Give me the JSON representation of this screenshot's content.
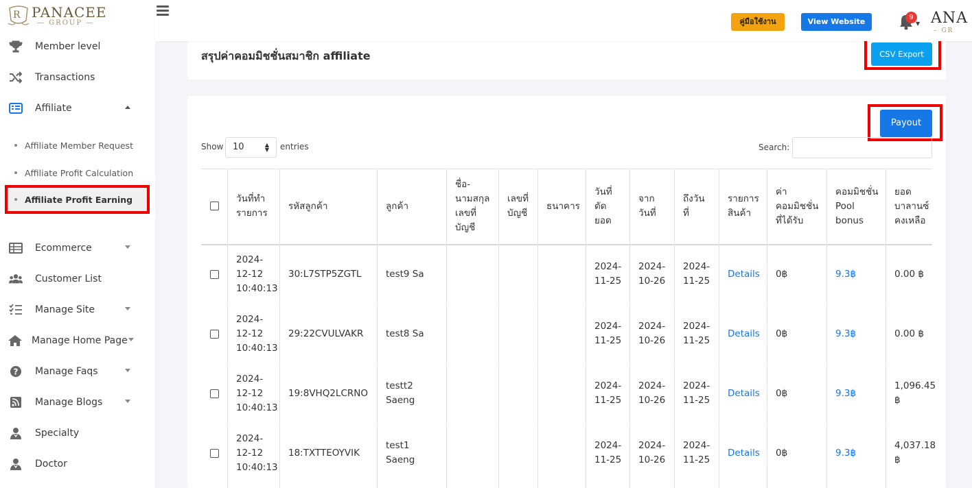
{
  "header": {
    "brand": "PANACEE",
    "brand_sub": "— GROUP —",
    "manual_label": "คู่มือใช้งาน",
    "website_label": "View Website",
    "notif_count": "9",
    "user_name": "ANA",
    "user_sub": "– GR"
  },
  "sidebar": {
    "items": [
      {
        "label": "Member level",
        "icon": "trophy-icon"
      },
      {
        "label": "Transactions",
        "icon": "shuffle-icon"
      },
      {
        "label": "Affiliate",
        "icon": "list-icon"
      },
      {
        "label": "Ecommerce",
        "icon": "table-icon"
      },
      {
        "label": "Customer List",
        "icon": "users-icon"
      },
      {
        "label": "Manage Site",
        "icon": "checklist-icon"
      },
      {
        "label": "Manage Home Page",
        "icon": "home-icon"
      },
      {
        "label": "Manage Faqs",
        "icon": "question-icon"
      },
      {
        "label": "Manage Blogs",
        "icon": "rss-icon"
      },
      {
        "label": "Specialty",
        "icon": "doctor-icon"
      },
      {
        "label": "Doctor",
        "icon": "doctor-icon"
      }
    ],
    "sub_items": [
      {
        "label": "Affiliate Member Request"
      },
      {
        "label": "Affiliate Profit Calculation"
      },
      {
        "label": "Affiliate Profit Earning"
      }
    ]
  },
  "page": {
    "title": "สรุปค่าคอมมิชชั่นสมาชิก affiliate",
    "csv_label": "CSV Export",
    "payout_label": "Payout",
    "show_label": "Show",
    "show_value": "10",
    "entries_label": "entries",
    "search_label": "Search:"
  },
  "table": {
    "headers": [
      "วันที่ทำรายการ",
      "รหัสลูกค้า",
      "ลูกค้า",
      "ชื่อ-นามสกุลเลขที่บัญชี",
      "เลขที่บัญชี",
      "ธนาคาร",
      "วันที่ตัดยอด",
      "จากวันที่",
      "ถึงวันที่",
      "รายการสินค้า",
      "ค่าคอมมิชชั่นที่ได้รับ",
      "คอมมิชชั่น Pool bonus",
      "ยอดบาลานซ์คงเหลือ"
    ],
    "header_lines": [
      [
        "วันที่ทำ",
        "รายการ"
      ],
      [
        "รหัสลูกค้า"
      ],
      [
        "ลูกค้า"
      ],
      [
        "ชื่อ-",
        "นามสกุล",
        "เลขที่",
        "บัญชี"
      ],
      [
        "เลขที่",
        "บัญชี"
      ],
      [
        "ธนาคาร"
      ],
      [
        "วันที่",
        "ตัด",
        "ยอด"
      ],
      [
        "จาก",
        "วันที่"
      ],
      [
        "ถึงวัน",
        "ที่"
      ],
      [
        "รายการ",
        "สินค้า"
      ],
      [
        "ค่า",
        "คอมมิชชั่น",
        "ที่ได้รับ"
      ],
      [
        "คอมมิชชั่น",
        "Pool",
        "bonus"
      ],
      [
        "ยอด",
        "บาลานซ์",
        "คงเหลือ"
      ]
    ],
    "rows": [
      {
        "date": [
          "2024-",
          "12-12",
          "10:40:13"
        ],
        "code": "30:L7STP5ZGTL",
        "customer": [
          "test9 Sa"
        ],
        "cut": [
          "2024-",
          "11-25"
        ],
        "from": [
          "2024-",
          "10-26"
        ],
        "to": [
          "2024-",
          "11-25"
        ],
        "details": "Details",
        "commission": "0฿",
        "pool": "9.3฿",
        "balance": [
          "0.00 ฿"
        ]
      },
      {
        "date": [
          "2024-",
          "12-12",
          "10:40:13"
        ],
        "code": "29:22CVULVAKR",
        "customer": [
          "test8 Sa"
        ],
        "cut": [
          "2024-",
          "11-25"
        ],
        "from": [
          "2024-",
          "10-26"
        ],
        "to": [
          "2024-",
          "11-25"
        ],
        "details": "Details",
        "commission": "0฿",
        "pool": "9.3฿",
        "balance": [
          "0.00 ฿"
        ]
      },
      {
        "date": [
          "2024-",
          "12-12",
          "10:40:13"
        ],
        "code": "19:8VHQ2LCRNO",
        "customer": [
          "testt2",
          "Saeng"
        ],
        "cut": [
          "2024-",
          "11-25"
        ],
        "from": [
          "2024-",
          "10-26"
        ],
        "to": [
          "2024-",
          "11-25"
        ],
        "details": "Details",
        "commission": "0฿",
        "pool": "9.3฿",
        "balance": [
          "1,096.45",
          "฿"
        ]
      },
      {
        "date": [
          "2024-",
          "12-12",
          "10:40:13"
        ],
        "code": "18:TXTTEOYVIK",
        "customer": [
          "test1",
          "Saeng"
        ],
        "cut": [
          "2024-",
          "11-25"
        ],
        "from": [
          "2024-",
          "10-26"
        ],
        "to": [
          "2024-",
          "11-25"
        ],
        "details": "Details",
        "commission": "0฿",
        "pool": "9.3฿",
        "balance": [
          "4,037.18",
          "฿"
        ]
      }
    ]
  },
  "colors": {
    "accent_blue": "#1677e6",
    "csv_blue": "#0aa0f0",
    "manual_orange": "#f2a30f",
    "highlight_red": "#ee0000",
    "badge_red": "#e53935"
  }
}
